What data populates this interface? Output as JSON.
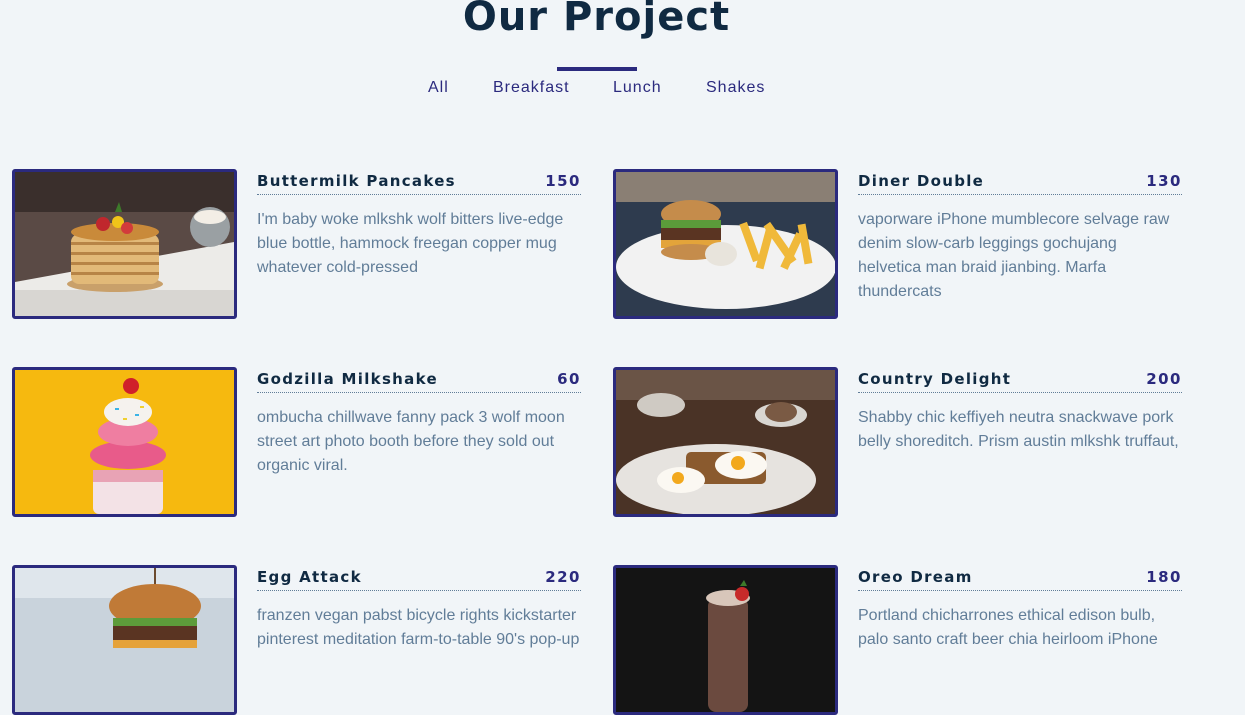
{
  "section": {
    "title": "Our Project"
  },
  "filters": [
    "All",
    "Breakfast",
    "Lunch",
    "Shakes"
  ],
  "menu": [
    {
      "name": "Buttermilk Pancakes",
      "price": "150",
      "desc": "I'm baby woke mlkshk wolf bitters live-edge blue bottle, hammock freegan copper mug whatever cold-pressed",
      "image_icon": "pancakes-photo"
    },
    {
      "name": "Diner Double",
      "price": "130",
      "desc": "vaporware iPhone mumblecore selvage raw denim slow-carb leggings gochujang helvetica man braid jianbing. Marfa thundercats",
      "image_icon": "burger-fries-photo"
    },
    {
      "name": "Godzilla Milkshake",
      "price": "60",
      "desc": "ombucha chillwave fanny pack 3 wolf moon street art photo booth before they sold out organic viral.",
      "image_icon": "milkshake-photo"
    },
    {
      "name": "Country Delight",
      "price": "200",
      "desc": "Shabby chic keffiyeh neutra snackwave pork belly shoreditch. Prism austin mlkshk truffaut,",
      "image_icon": "eggs-toast-photo"
    },
    {
      "name": "Egg Attack",
      "price": "220",
      "desc": "franzen vegan pabst bicycle rights kickstarter pinterest meditation farm-to-table 90's pop-up",
      "image_icon": "egg-burger-photo"
    },
    {
      "name": "Oreo Dream",
      "price": "180",
      "desc": "Portland chicharrones ethical edison bulb, palo santo craft beer chia heirloom iPhone",
      "image_icon": "oreo-shake-photo"
    }
  ],
  "colors": {
    "accent": "#2b2a7e",
    "heading": "#102a42",
    "text": "#617d98",
    "background": "#f1f5f8"
  }
}
